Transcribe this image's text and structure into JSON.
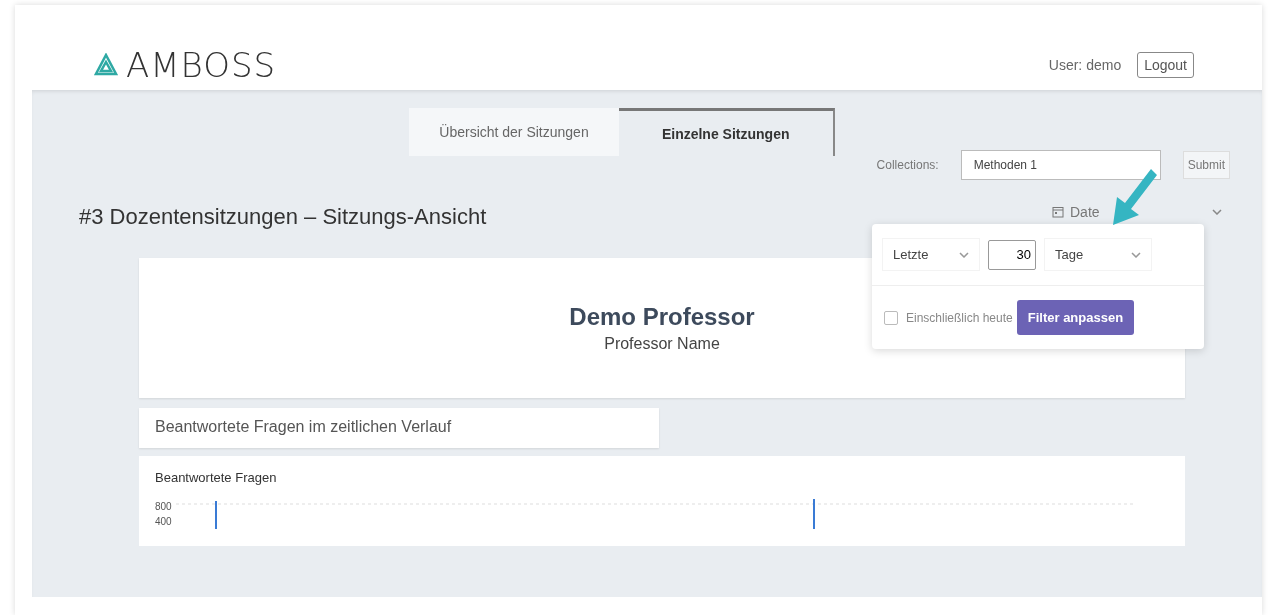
{
  "header": {
    "logo": "AMBOSS",
    "user": "User: demo",
    "logout": "Logout"
  },
  "tabs": [
    {
      "label": "Übersicht der Sitzungen",
      "selected": false
    },
    {
      "label": "Einzelne Sitzungen",
      "selected": true
    }
  ],
  "collections": {
    "label": "Collections:",
    "value": "Methoden 1",
    "submit": "Submit"
  },
  "page_title": "#3 Dozentensitzungen – Sitzungs-Ansicht",
  "date_filter": {
    "label": "Date",
    "expanded": true,
    "mode": "Letzte",
    "amount": "30",
    "unit": "Tage",
    "include_today": {
      "label": "Einschließlich heute",
      "checked": false
    },
    "apply": "Filter anpassen"
  },
  "profile": {
    "name": "Demo Professor",
    "subtitle": "Professor Name"
  },
  "section_title": "Beantwortete Fragen im zeitlichen Verlauf",
  "chart": {
    "title": "Beantwortete Fragen",
    "y_labels": [
      "800",
      "400"
    ]
  }
}
